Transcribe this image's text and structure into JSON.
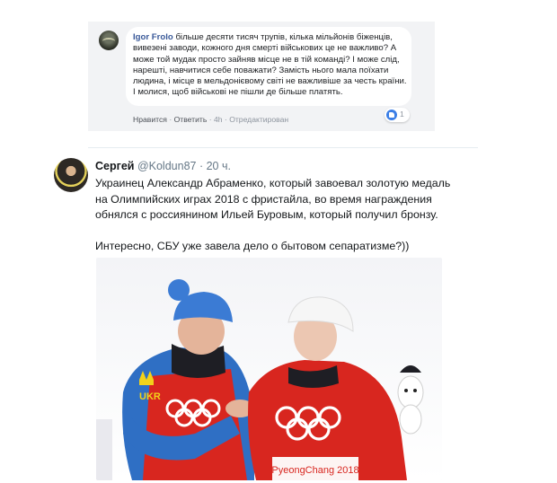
{
  "fb_comment": {
    "author": "Igor Frolo",
    "text": "більше десяти тисяч трупів, кілька мільйонів біженців, вивезені заводи, кожного дня смерті військових це не важливо? А може той мудак просто зайняв місце не в тій команді? І може слід, нарешті, навчитися себе поважати? Замість нього мала поїхати людина, і місце в мельдонієвому світі не важливіше за честь країни. І молися, щоб військові не пішли де більше платять.",
    "like_action": "Нравится",
    "reply_action": "Ответить",
    "sep": "·",
    "time": "4h",
    "edited": "Отредактирован",
    "like_count": "1"
  },
  "tweet": {
    "name": "Сергей",
    "handle": "@Koldun87",
    "sep": "·",
    "time": "20 ч.",
    "text_1": "Украинец Александр Абраменко, который завоевал золотую медаль на Олимпийских играх 2018 с фристайла, во время награждения обнялся с россиянином Ильей Буровым, который получил бронзу.",
    "text_2": "Интересно, СБУ уже завела дело о бытовом сепаратизме?))"
  },
  "photo": {
    "bib_left_code": "UKR",
    "bib_right_text": "PyeongChang 2018",
    "colors": {
      "ukr_blue": "#2f6fc4",
      "bib_red": "#d8261f",
      "hat_blue": "#3b7bd4"
    }
  }
}
